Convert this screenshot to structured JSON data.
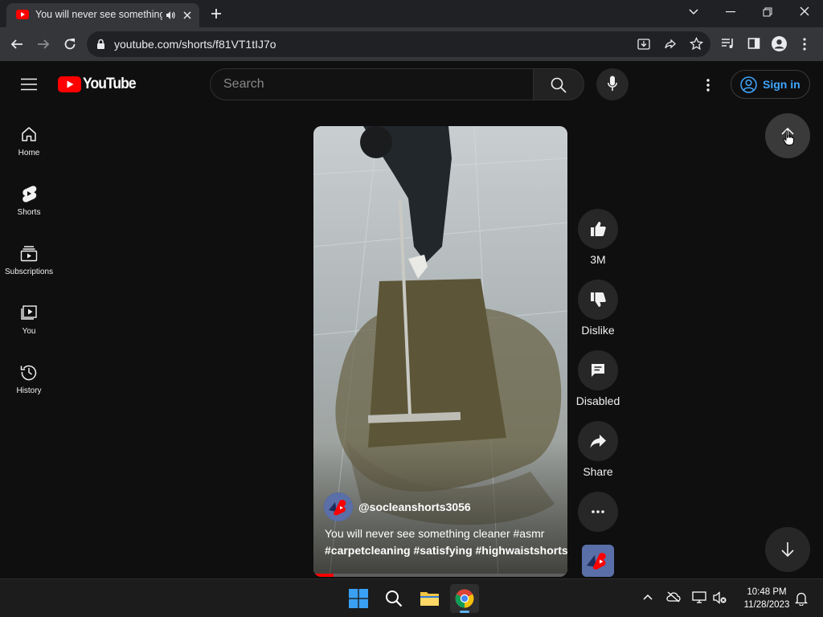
{
  "browser": {
    "tab_title": "You will never see something cleaner #asmr #carpetcleaning",
    "url": "youtube.com/shorts/f81VT1tIJ7o"
  },
  "youtube": {
    "logo_text": "YouTube",
    "search_placeholder": "Search",
    "sign_in": "Sign in",
    "sidebar": [
      {
        "label": "Home",
        "icon": "home-icon"
      },
      {
        "label": "Shorts",
        "icon": "shorts-icon"
      },
      {
        "label": "Subscriptions",
        "icon": "subscriptions-icon"
      },
      {
        "label": "You",
        "icon": "you-icon"
      },
      {
        "label": "History",
        "icon": "history-icon"
      }
    ],
    "short": {
      "channel": "@socleanshorts3056",
      "caption_line1": "You will never see something cleaner #asmr",
      "caption_line2": "#carpetcleaning #satisfying #highwaistshorts",
      "progress": 0.08
    },
    "actions": {
      "likes": "3M",
      "dislike": "Dislike",
      "comments": "Disabled",
      "share": "Share"
    }
  },
  "taskbar": {
    "time": "10:48 PM",
    "date": "11/28/2023"
  },
  "colors": {
    "youtube_red": "#ff0000",
    "link_blue": "#3ea6ff",
    "background": "#0f0f0f"
  }
}
